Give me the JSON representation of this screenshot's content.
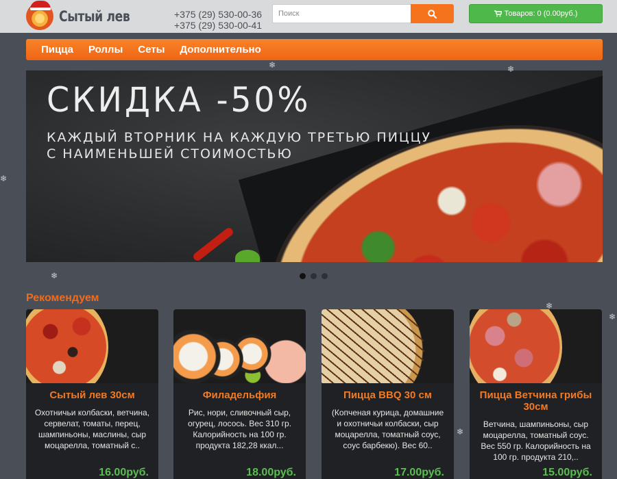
{
  "header": {
    "logo_text": "Сытый лев",
    "phone_1": "+375 (29) 530-00-36",
    "phone_2": "+375 (29) 530-00-41",
    "search_placeholder": "Поиск",
    "search_icon": "search-icon",
    "cart_label": "Товаров: 0 (0.00руб.)",
    "cart_icon": "cart-icon",
    "colors": {
      "accent": "#f4731c",
      "cart": "#4fb84a",
      "background": "#4a4f57"
    }
  },
  "nav": {
    "items": [
      {
        "label": "Пицца"
      },
      {
        "label": "Роллы"
      },
      {
        "label": "Сеты"
      },
      {
        "label": "Дополнительно"
      }
    ]
  },
  "banner": {
    "title": "СКИДКА -50%",
    "subtitle_line1": "Каждый вторник на каждую третью пиццу",
    "subtitle_line2": "с наименьшей стоимостью",
    "slides_count": 3,
    "active_slide": 1
  },
  "recommend": {
    "title": "Рекомендуем",
    "products": [
      {
        "name": "Сытый лев 30см",
        "desc": "Охотничьи колбаски, ветчина, сервелат, томаты, перец, шампиньоны, маслины, сыр моцарелла, томатный с..",
        "price": "16.00руб."
      },
      {
        "name": "Филадельфия",
        "desc": "Рис, нори, сливочный сыр, огурец, лосось. Вес 310 гр. Калорийность на 100 гр. продукта 182,28 ккал...",
        "price": "18.00руб."
      },
      {
        "name": "Пицца BBQ 30 см",
        "desc": "(Копченая курица, домашние и охотничьи колбаски, сыр моцарелла, томатный соус, соус барбекю). Вес 60..",
        "price": "17.00руб."
      },
      {
        "name": "Пицца Ветчина грибы 30см",
        "desc": "Ветчина, шампиньоны, сыр моцарелла, томатный соус. Вес 550 гр. Калорийность на 100 гр. продукта 210,..",
        "price": "15.00руб."
      }
    ]
  }
}
